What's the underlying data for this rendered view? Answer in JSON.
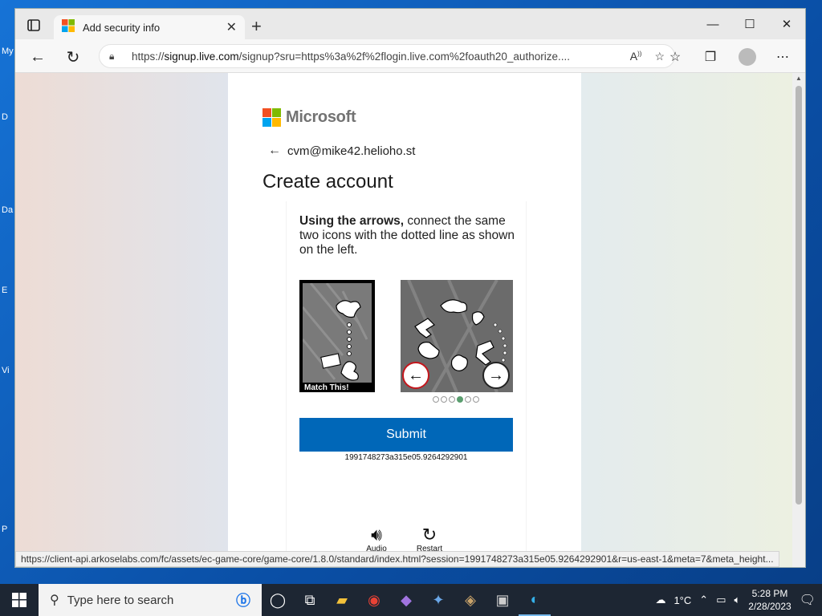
{
  "desktop": {
    "labels": [
      "My",
      "D",
      "Da",
      "E",
      "Vi",
      "P"
    ]
  },
  "browser": {
    "tab_title": "Add security info",
    "url_prefix": "https://",
    "url_host": "signup.live.com",
    "url_rest": "/signup?sru=https%3a%2f%2flogin.live.com%2foauth20_authorize....",
    "status_url": "https://client-api.arkoselabs.com/fc/assets/ec-game-core/game-core/1.8.0/standard/index.html?session=1991748273a315e05.9264292901&r=us-east-1&meta=7&meta_height..."
  },
  "page": {
    "brand": "Microsoft",
    "email": "cvm@mike42.helioho.st",
    "heading": "Create account",
    "instruction_bold": "Using the arrows,",
    "instruction_rest": " connect the same two icons with the dotted line as shown on the left.",
    "match_label": "Match This!",
    "submit_label": "Submit",
    "session_id": "1991748273a315e05.9264292901",
    "audio_label": "Audio",
    "restart_label": "Restart",
    "dots_total": 6,
    "dots_active_index": 3,
    "brand_colors": [
      "#f25022",
      "#7fba00",
      "#00a4ef",
      "#ffb900"
    ]
  },
  "taskbar": {
    "search_placeholder": "Type here to search",
    "temperature": "1°C",
    "time": "5:28 PM",
    "date": "2/28/2023"
  }
}
